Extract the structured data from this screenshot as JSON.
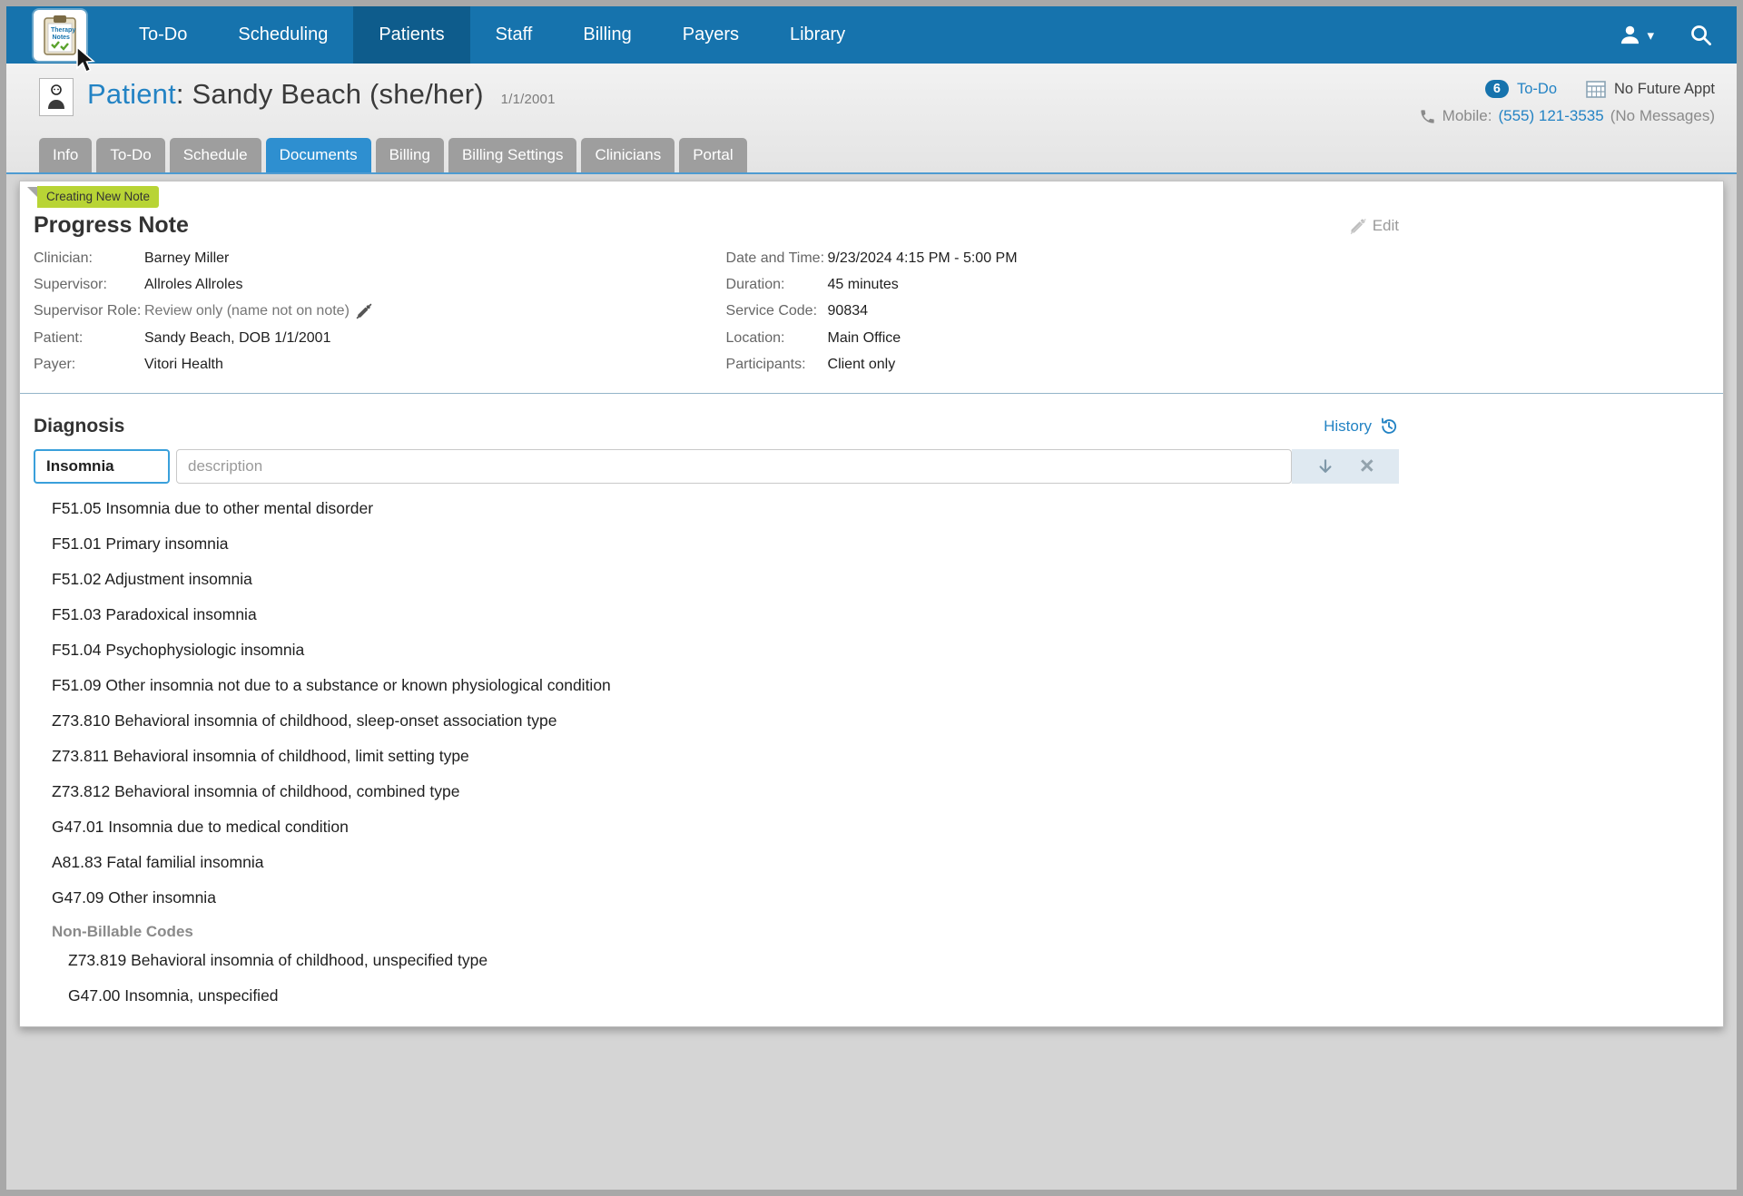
{
  "brand": {
    "line1": "Therapy",
    "line2": "Notes"
  },
  "nav": {
    "items": [
      {
        "label": "To-Do",
        "active": false
      },
      {
        "label": "Scheduling",
        "active": false
      },
      {
        "label": "Patients",
        "active": true
      },
      {
        "label": "Staff",
        "active": false
      },
      {
        "label": "Billing",
        "active": false
      },
      {
        "label": "Payers",
        "active": false
      },
      {
        "label": "Library",
        "active": false
      }
    ]
  },
  "icons": {
    "caret": "▾",
    "clear": "×"
  },
  "patient_header": {
    "title_label": "Patient",
    "title_rest": ": Sandy Beach (she/her)",
    "dob": "1/1/2001",
    "todo_count": "6",
    "todo_label": "To-Do",
    "no_future_appt": "No Future Appt",
    "mobile_label": "Mobile:",
    "mobile_number": "(555) 121-3535",
    "mobile_suffix": "(No Messages)"
  },
  "tabs": [
    {
      "label": "Info",
      "active": false
    },
    {
      "label": "To-Do",
      "active": false
    },
    {
      "label": "Schedule",
      "active": false
    },
    {
      "label": "Documents",
      "active": true
    },
    {
      "label": "Billing",
      "active": false
    },
    {
      "label": "Billing Settings",
      "active": false
    },
    {
      "label": "Clinicians",
      "active": false
    },
    {
      "label": "Portal",
      "active": false
    }
  ],
  "note": {
    "badge": "Creating New Note",
    "title": "Progress Note",
    "edit_label": "Edit",
    "fields_left": [
      {
        "label": "Clinician:",
        "value": "Barney Miller"
      },
      {
        "label": "Supervisor:",
        "value": "Allroles Allroles"
      },
      {
        "label": "Supervisor Role:",
        "value": "Review only (name not on note)"
      },
      {
        "label": "Patient:",
        "value": "Sandy Beach, DOB 1/1/2001"
      },
      {
        "label": "Payer:",
        "value": "Vitori Health"
      }
    ],
    "fields_right": [
      {
        "label": "Date and Time:",
        "value": "9/23/2024 4:15 PM - 5:00 PM"
      },
      {
        "label": "Duration:",
        "value": "45 minutes"
      },
      {
        "label": "Service Code:",
        "value": "90834"
      },
      {
        "label": "Location:",
        "value": "Main Office"
      },
      {
        "label": "Participants:",
        "value": "Client only"
      }
    ]
  },
  "diagnosis": {
    "title": "Diagnosis",
    "history_label": "History",
    "search_value": "Insomnia",
    "description_placeholder": "description",
    "results": [
      "F51.05 Insomnia due to other mental disorder",
      "F51.01 Primary insomnia",
      "F51.02 Adjustment insomnia",
      "F51.03 Paradoxical insomnia",
      "F51.04 Psychophysiologic insomnia",
      "F51.09 Other insomnia not due to a substance or known physiological condition",
      "Z73.810 Behavioral insomnia of childhood, sleep-onset association type",
      "Z73.811 Behavioral insomnia of childhood, limit setting type",
      "Z73.812 Behavioral insomnia of childhood, combined type",
      "G47.01 Insomnia due to medical condition",
      "A81.83 Fatal familial insomnia",
      "G47.09 Other insomnia"
    ],
    "non_billable_header": "Non-Billable Codes",
    "non_billable": [
      "Z73.819 Behavioral insomnia of childhood, unspecified type",
      "G47.00 Insomnia, unspecified"
    ]
  }
}
